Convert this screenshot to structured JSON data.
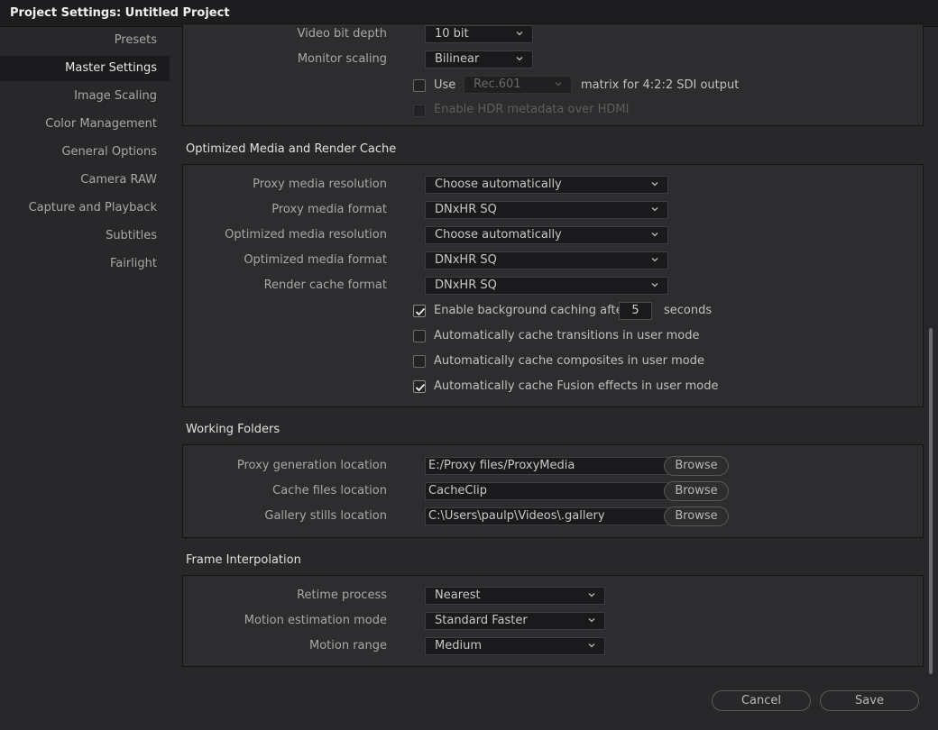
{
  "window": {
    "title": "Project Settings:  Untitled Project"
  },
  "sidebar": {
    "items": [
      {
        "label": "Presets",
        "active": false
      },
      {
        "label": "Master Settings",
        "active": true
      },
      {
        "label": "Image Scaling",
        "active": false
      },
      {
        "label": "Color Management",
        "active": false
      },
      {
        "label": "General Options",
        "active": false
      },
      {
        "label": "Camera RAW",
        "active": false
      },
      {
        "label": "Capture and Playback",
        "active": false
      },
      {
        "label": "Subtitles",
        "active": false
      },
      {
        "label": "Fairlight",
        "active": false
      }
    ]
  },
  "video_monitoring": {
    "bit_depth": {
      "label": "Video bit depth",
      "value": "10 bit"
    },
    "monitor_scaling": {
      "label": "Monitor scaling",
      "value": "Bilinear"
    },
    "use_matrix": {
      "prefix": "Use",
      "value": "Rec.601",
      "suffix": "matrix for 4:2:2 SDI output",
      "checked": false
    },
    "hdr_metadata": {
      "label": "Enable HDR metadata over HDMI",
      "checked": false,
      "disabled": true
    }
  },
  "optimized_media": {
    "title": "Optimized Media and Render Cache",
    "proxy_resolution": {
      "label": "Proxy media resolution",
      "value": "Choose automatically"
    },
    "proxy_format": {
      "label": "Proxy media format",
      "value": "DNxHR SQ"
    },
    "optimized_resolution": {
      "label": "Optimized media resolution",
      "value": "Choose automatically"
    },
    "optimized_format": {
      "label": "Optimized media format",
      "value": "DNxHR SQ"
    },
    "render_cache_format": {
      "label": "Render cache format",
      "value": "DNxHR SQ"
    },
    "bg_caching": {
      "label": "Enable background caching after",
      "value": "5",
      "unit": "seconds",
      "checked": true
    },
    "cache_transitions": {
      "label": "Automatically cache transitions in user mode",
      "checked": false
    },
    "cache_composites": {
      "label": "Automatically cache composites in user mode",
      "checked": false
    },
    "cache_fusion": {
      "label": "Automatically cache Fusion effects in user mode",
      "checked": true
    }
  },
  "working_folders": {
    "title": "Working Folders",
    "browse_label": "Browse",
    "proxy_location": {
      "label": "Proxy generation location",
      "value": "E:/Proxy files/ProxyMedia"
    },
    "cache_location": {
      "label": "Cache files location",
      "value": "CacheClip"
    },
    "gallery_location": {
      "label": "Gallery stills location",
      "value": "C:\\Users\\paulp\\Videos\\.gallery"
    }
  },
  "frame_interpolation": {
    "title": "Frame Interpolation",
    "retime_process": {
      "label": "Retime process",
      "value": "Nearest"
    },
    "motion_estimation": {
      "label": "Motion estimation mode",
      "value": "Standard Faster"
    },
    "motion_range": {
      "label": "Motion range",
      "value": "Medium"
    }
  },
  "footer": {
    "cancel_label": "Cancel",
    "save_label": "Save"
  },
  "icons": {
    "dropdown": "chevron-down-icon",
    "checkbox": "check-icon"
  },
  "colors": {
    "background": "#28282a",
    "titlebar": "#1d1d1f",
    "panel": "#2d2d2f",
    "field": "#1a1a1c",
    "text": "#c4c4c4"
  }
}
